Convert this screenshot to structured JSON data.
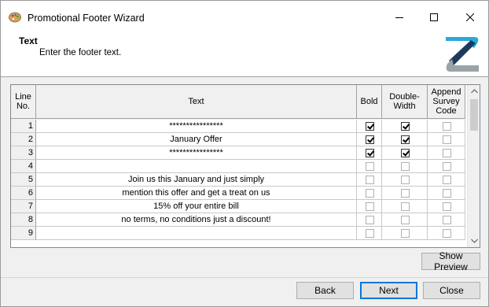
{
  "window": {
    "title": "Promotional Footer Wizard",
    "icon": "paint-palette-icon"
  },
  "header": {
    "title": "Text",
    "subtitle": "Enter the footer text.",
    "logo": "z-brand-logo"
  },
  "grid": {
    "columns": {
      "line_no": "Line No.",
      "text": "Text",
      "bold": "Bold",
      "double_width": "Double-Width",
      "append_survey": "Append Survey Code"
    },
    "rows": [
      {
        "no": "1",
        "text": "****************",
        "bold": true,
        "double": true,
        "append": false
      },
      {
        "no": "2",
        "text": "January Offer",
        "bold": true,
        "double": true,
        "append": false
      },
      {
        "no": "3",
        "text": "****************",
        "bold": true,
        "double": true,
        "append": false
      },
      {
        "no": "4",
        "text": "",
        "bold": false,
        "double": false,
        "append": false
      },
      {
        "no": "5",
        "text": "Join us this January and just simply",
        "bold": false,
        "double": false,
        "append": false
      },
      {
        "no": "6",
        "text": "mention this offer and get a treat on us",
        "bold": false,
        "double": false,
        "append": false
      },
      {
        "no": "7",
        "text": "15% off your entire bill",
        "bold": false,
        "double": false,
        "append": false
      },
      {
        "no": "8",
        "text": "no terms, no conditions just a discount!",
        "bold": false,
        "double": false,
        "append": false
      },
      {
        "no": "9",
        "text": "",
        "bold": false,
        "double": false,
        "append": false
      }
    ]
  },
  "buttons": {
    "show_preview": "Show Preview",
    "back": "Back",
    "next": "Next",
    "close": "Close"
  },
  "colors": {
    "logo_teal": "#29a9d8",
    "logo_navy": "#1c3b5c",
    "logo_gray": "#9aa3a8",
    "default_button_border": "#0078d7"
  }
}
